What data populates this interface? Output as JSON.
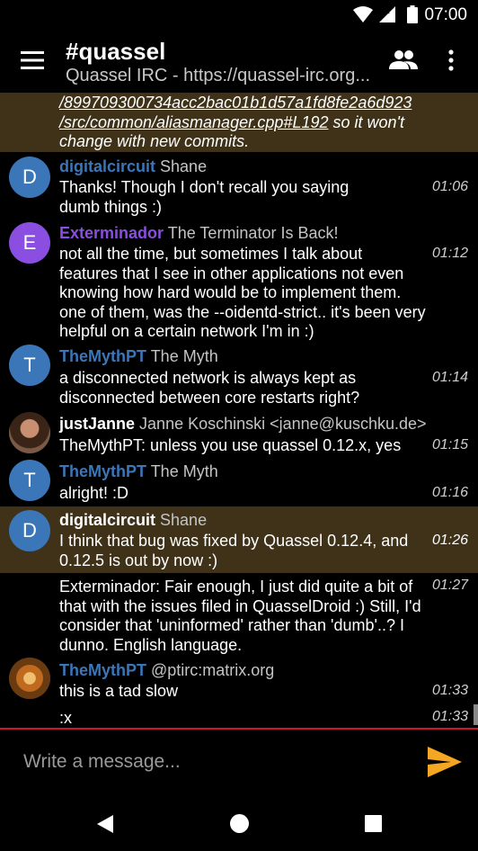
{
  "status_bar": {
    "time": "07:00"
  },
  "app_bar": {
    "title": "#quassel",
    "subtitle": "Quassel IRC - https://quassel-irc.org..."
  },
  "link_message": {
    "line1": "/899709300734acc2bac01b1d57a1fd8fe2a6d923",
    "line2_link": "/src/common/aliasmanager.cpp#L192",
    "line2_rest": " so it won't",
    "line3": "change with new commits."
  },
  "messages": [
    {
      "avatar_letter": "D",
      "avatar_color": "#3a76b8",
      "nick": "digitalcircuit",
      "nick_color": "#3a76b8",
      "realname": "Shane",
      "lines": [
        "Thanks!  Though I don't recall you saying",
        "dumb things :)"
      ],
      "time": "01:06"
    },
    {
      "avatar_letter": "E",
      "avatar_color": "#8a4ee0",
      "nick": "Exterminador",
      "nick_color": "#8a4ee0",
      "realname": "The Terminator Is Back!",
      "lines": [
        "not all the time, but sometimes I talk about",
        "features that I see in other applications not even",
        "knowing how hard would be to implement them.",
        "one of them, was the --oidentd-strict.. it's been very",
        "helpful on a certain network I'm in :)"
      ],
      "time": "01:12"
    },
    {
      "avatar_letter": "T",
      "avatar_color": "#3a76b8",
      "nick": "TheMythPT",
      "nick_color": "#3a76b8",
      "realname": "The Myth",
      "lines": [
        "a disconnected network is always kept as",
        "disconnected between core restarts right?"
      ],
      "time": "01:14"
    },
    {
      "avatar_letter": "",
      "avatar_color": "#5a3a2a",
      "nick": "justJanne",
      "nick_color": "#ffffff",
      "realname": "Janne Koschinski <janne@kuschku.de>",
      "lines": [
        "TheMythPT: unless you use quassel 0.12.x, yes"
      ],
      "time": "01:15"
    },
    {
      "avatar_letter": "T",
      "avatar_color": "#3a76b8",
      "nick": "TheMythPT",
      "nick_color": "#3a76b8",
      "realname": "The Myth",
      "lines": [
        "alright! :D"
      ],
      "time": "01:16"
    },
    {
      "avatar_letter": "D",
      "avatar_color": "#3a76b8",
      "nick": "digitalcircuit",
      "nick_color": "#ffffff",
      "realname": "Shane",
      "lines": [
        "I think that bug was fixed by Quassel 0.12.4, and",
        "0.12.5 is out by now :)"
      ],
      "time": "01:26"
    },
    {
      "lines": [
        "Exterminador: Fair enough, I just did quite a bit of",
        "that with the issues filed in QuasselDroid :)  Still, I'd",
        "consider that 'uninformed' rather than 'dumb'..?  I",
        "dunno.  English language."
      ],
      "time": "01:27"
    },
    {
      "avatar_letter": "",
      "avatar_color": "#b06a20",
      "nick": "TheMythPT",
      "nick_color": "#3a76b8",
      "realname": "@ptirc:matrix.org",
      "lines": [
        "this is a tad slow"
      ],
      "time": "01:33"
    },
    {
      "lines": [
        ":x"
      ],
      "time": "01:33"
    }
  ],
  "composer": {
    "placeholder": "Write a message..."
  },
  "colors": {
    "accent": "#f5a623",
    "highlight_bg": "#3f3219",
    "divider": "#d1132b"
  },
  "icons": [
    "wifi-icon",
    "lte-signal-icon",
    "battery-icon",
    "menu-icon",
    "people-icon",
    "more-vert-icon",
    "send-icon",
    "back-icon",
    "home-icon",
    "recents-icon"
  ]
}
